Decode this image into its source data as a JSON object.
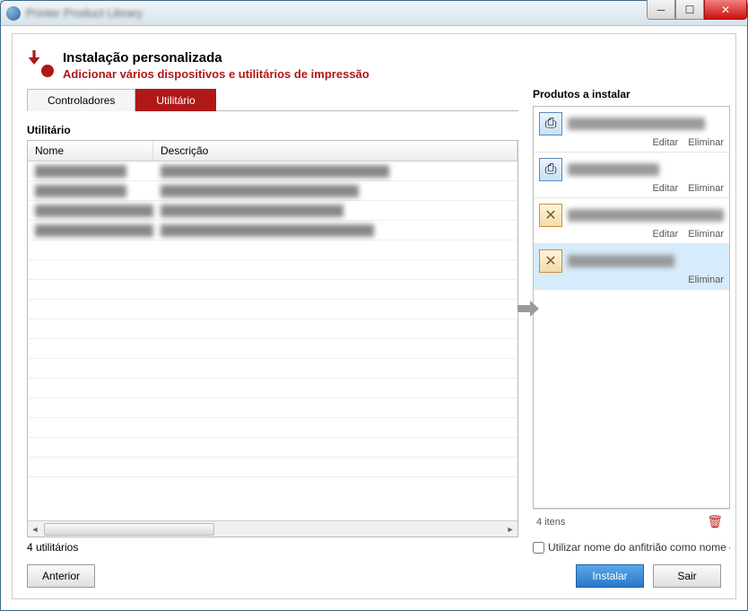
{
  "window": {
    "title": "Printer Product Library"
  },
  "header": {
    "title": "Instalação personalizada",
    "subtitle": "Adicionar vários dispositivos e utilitários de impressão"
  },
  "tabs": {
    "controllers": "Controladores",
    "utility": "Utilitário"
  },
  "table": {
    "section_label": "Utilitário",
    "col_name": "Nome",
    "col_desc": "Descrição",
    "rows": [
      {
        "name": "████████████",
        "desc": "██████████████████████████████"
      },
      {
        "name": "████████████",
        "desc": "██████████████████████████"
      },
      {
        "name": "████████████████",
        "desc": "████████████████████████"
      },
      {
        "name": "████████████████",
        "desc": "████████████████████████████"
      }
    ],
    "count_label": "4 utilitários"
  },
  "right": {
    "title": "Produtos a instalar",
    "edit": "Editar",
    "remove": "Eliminar",
    "items_count": "4 itens",
    "checkbox_label": "Utilizar nome do anfitrião como nome da porta",
    "products": [
      {
        "name": "██████████████████",
        "icon": "printer",
        "editable": true
      },
      {
        "name": "████████████",
        "icon": "printer",
        "editable": true
      },
      {
        "name": "██████████████████████████",
        "icon": "tool",
        "editable": true
      },
      {
        "name": "██████████████",
        "icon": "tool",
        "editable": false
      }
    ]
  },
  "buttons": {
    "back": "Anterior",
    "install": "Instalar",
    "exit": "Sair"
  }
}
